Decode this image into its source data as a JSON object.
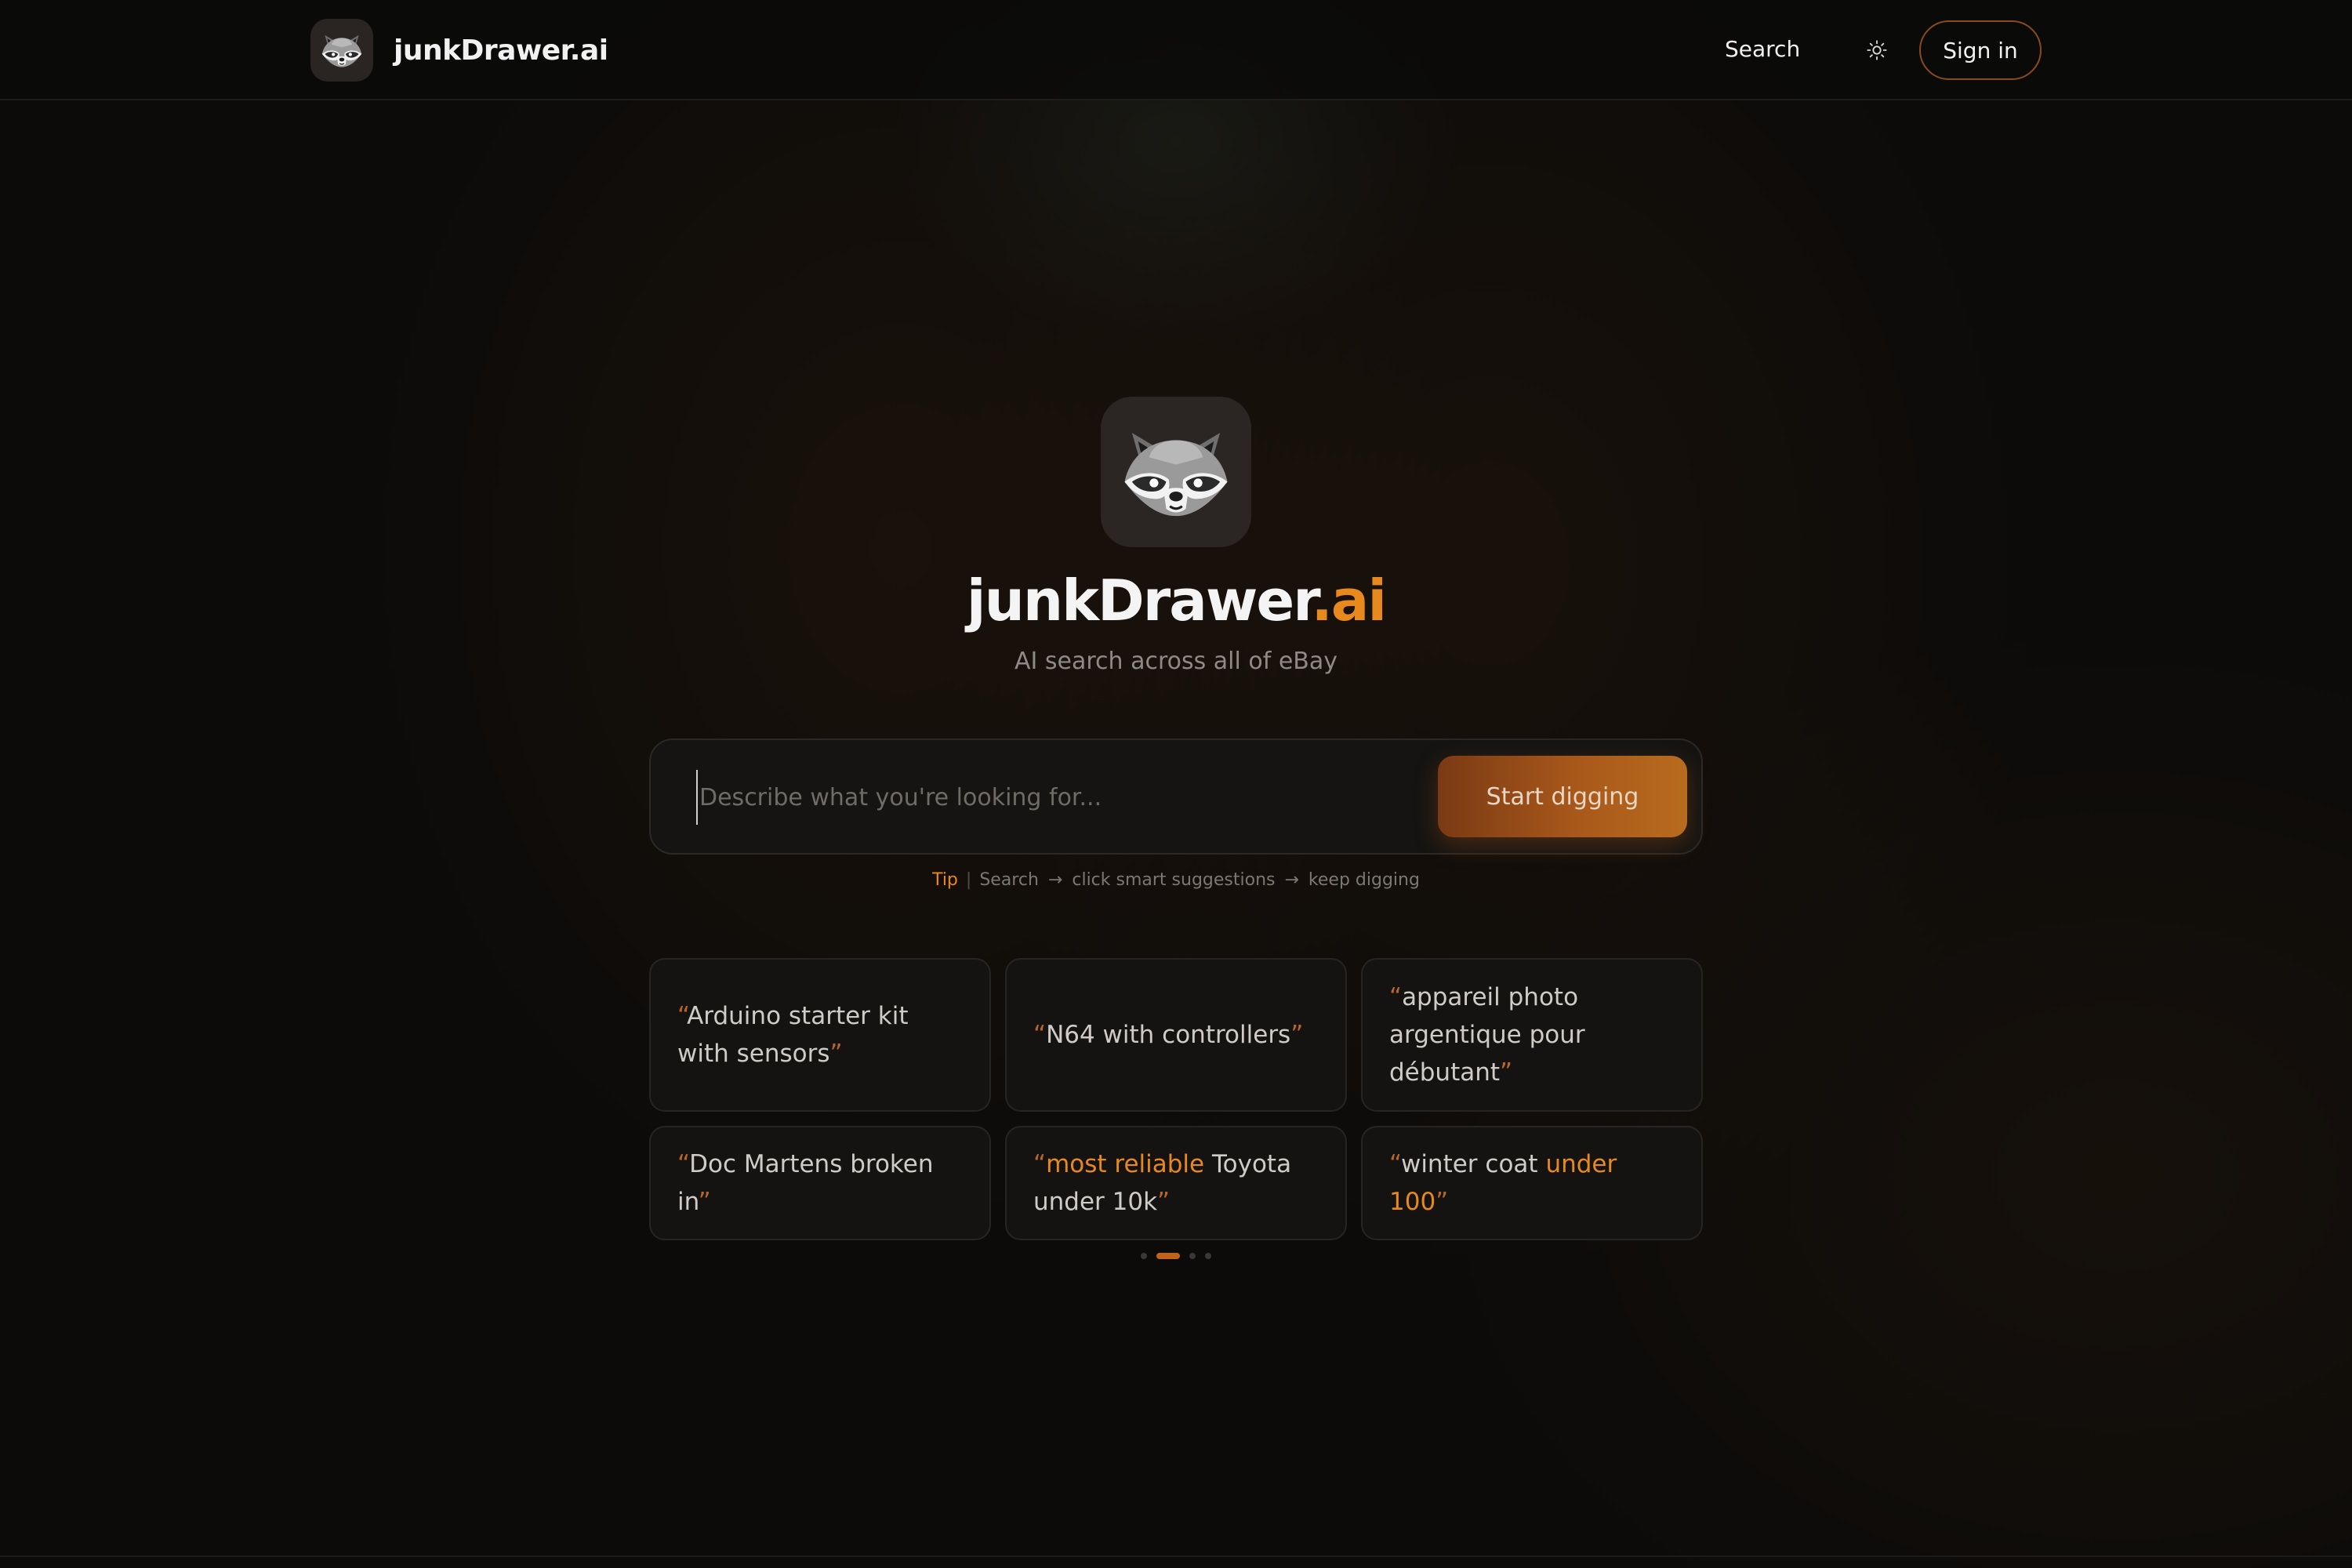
{
  "header": {
    "brand_name": "junkDrawer.ai",
    "nav_search": "Search",
    "sign_in": "Sign in",
    "logo_icon": "raccoon-icon",
    "theme_icon": "sun-icon"
  },
  "hero": {
    "title_main": "junkDrawer",
    "title_accent": ".ai",
    "subtitle": "AI search across all of eBay",
    "logo_icon": "raccoon-icon"
  },
  "search": {
    "placeholder": "Describe what you're looking for...",
    "value": "",
    "button_label": "Start digging"
  },
  "tip": {
    "label": "Tip",
    "separator": "|",
    "steps": [
      "Search",
      "click smart suggestions",
      "keep digging"
    ],
    "arrow": "→"
  },
  "suggestions": [
    {
      "parts": [
        {
          "text": "Arduino starter kit with sensors",
          "highlight": false
        }
      ]
    },
    {
      "parts": [
        {
          "text": "N64 with controllers",
          "highlight": false
        }
      ]
    },
    {
      "parts": [
        {
          "text": "appareil photo argentique pour débutant",
          "highlight": false
        }
      ]
    },
    {
      "parts": [
        {
          "text": "Doc Martens broken in",
          "highlight": false
        }
      ]
    },
    {
      "parts": [
        {
          "text": "most reliable",
          "highlight": true
        },
        {
          "text": " Toyota under 10k",
          "highlight": false
        }
      ]
    },
    {
      "parts": [
        {
          "text": "winter coat ",
          "highlight": false
        },
        {
          "text": "under 100",
          "highlight": true
        }
      ]
    }
  ],
  "quote_open": "“",
  "quote_close": "”",
  "pager": {
    "total": 4,
    "active_index": 1
  },
  "colors": {
    "accent": "#e8891e",
    "background": "#0c0b0a",
    "button_start": "#7a3a14",
    "button_end": "#b86c1e"
  }
}
